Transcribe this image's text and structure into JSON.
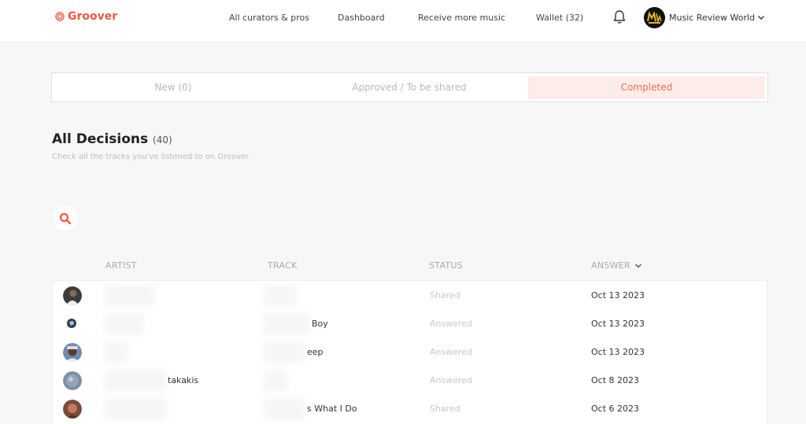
{
  "header": {
    "logo": "Groover",
    "nav": [
      "All curators & pros",
      "Dashboard",
      "Receive more music",
      "Wallet (32)"
    ],
    "user_name": "Music Review World"
  },
  "tabs": [
    {
      "label": "New (0)",
      "active": false
    },
    {
      "label": "Approved / To be shared",
      "active": false
    },
    {
      "label": "Completed",
      "active": true
    }
  ],
  "main": {
    "title": "All Decisions",
    "count": "(40)",
    "subtitle": "Check all the tracks you've listened to on Groover"
  },
  "table": {
    "headers": {
      "artist": "ARTIST",
      "track": "TRACK",
      "status": "STATUS",
      "answer": "ANSWER"
    },
    "rows": [
      {
        "artist": "",
        "track": "",
        "status": "Shared",
        "answer": "Oct 13 2023"
      },
      {
        "artist": "",
        "track": "Boy",
        "status": "Answered",
        "answer": "Oct 13 2023"
      },
      {
        "artist": "",
        "track": "eep",
        "status": "Answered",
        "answer": "Oct 13 2023"
      },
      {
        "artist": "takakis",
        "track": "",
        "status": "Answered",
        "answer": "Oct 8 2023"
      },
      {
        "artist": "",
        "track": "s What I Do",
        "status": "Shared",
        "answer": "Oct 6 2023"
      }
    ]
  },
  "colors": {
    "brand": "#f0573f",
    "active_tab_bg": "#fdece7"
  }
}
